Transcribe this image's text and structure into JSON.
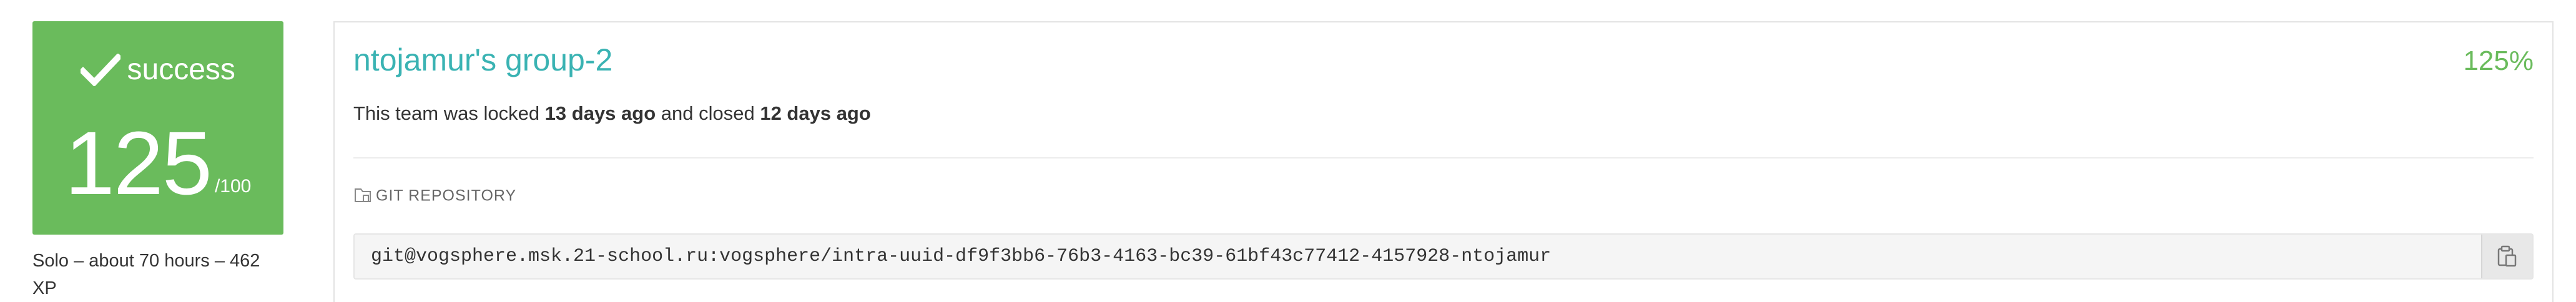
{
  "score_card": {
    "status": "success",
    "score": "125",
    "max": "/100",
    "background_color": "#6abb5c",
    "icon": "check-icon"
  },
  "project_meta": "Solo – about 70 hours – 462 XP",
  "team": {
    "title": "ntojamur's group-2",
    "percent": "125%",
    "title_color": "#3ab3b3",
    "percent_color": "#6abb5c"
  },
  "lock_info": {
    "prefix": "This team was locked ",
    "locked": "13 days ago",
    "middle": " and closed ",
    "closed": "12 days ago"
  },
  "repository": {
    "label": "GIT REPOSITORY",
    "label_icon": "folder-icon",
    "url": "git@vogsphere.msk.21-school.ru:vogsphere/intra-uuid-df9f3bb6-76b3-4163-bc39-61bf43c77412-4157928-ntojamur",
    "copy_icon": "clipboard-icon"
  }
}
